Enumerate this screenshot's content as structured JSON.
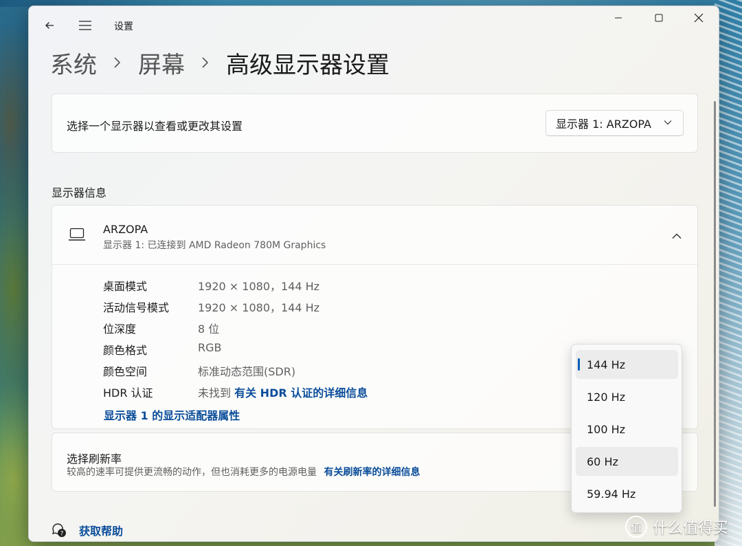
{
  "app": {
    "title": "设置"
  },
  "breadcrumb": {
    "item1": "系统",
    "item2": "屏幕",
    "current": "高级显示器设置"
  },
  "display_select": {
    "label": "选择一个显示器以查看或更改其设置",
    "value": "显示器 1: ARZOPA"
  },
  "section_title": "显示器信息",
  "monitor": {
    "name": "ARZOPA",
    "subtitle": "显示器 1: 已连接到 AMD Radeon 780M Graphics",
    "props": [
      {
        "key": "桌面模式",
        "value": "1920 × 1080，144 Hz"
      },
      {
        "key": "活动信号模式",
        "value": "1920 × 1080，144 Hz"
      },
      {
        "key": "位深度",
        "value": "8 位"
      },
      {
        "key": "颜色格式",
        "value": "RGB"
      },
      {
        "key": "颜色空间",
        "value": "标准动态范围(SDR)"
      },
      {
        "key": "HDR 认证",
        "value": "未找到",
        "link": "有关 HDR 认证的详细信息"
      }
    ],
    "adapter_link": "显示器 1 的显示适配器属性"
  },
  "refresh": {
    "title": "选择刷新率",
    "desc": "较高的速率可提供更流畅的动作，但也消耗更多的电源电量",
    "link": "有关刷新率的详细信息"
  },
  "refresh_options": [
    "144 Hz",
    "120 Hz",
    "100 Hz",
    "60 Hz",
    "59.94 Hz"
  ],
  "refresh_selected": "144 Hz",
  "help": {
    "label": "获取帮助"
  },
  "watermark": {
    "logo": "值",
    "text": "什么值得买"
  },
  "colors": {
    "accent": "#005fb8",
    "link": "#0a4d9a"
  }
}
